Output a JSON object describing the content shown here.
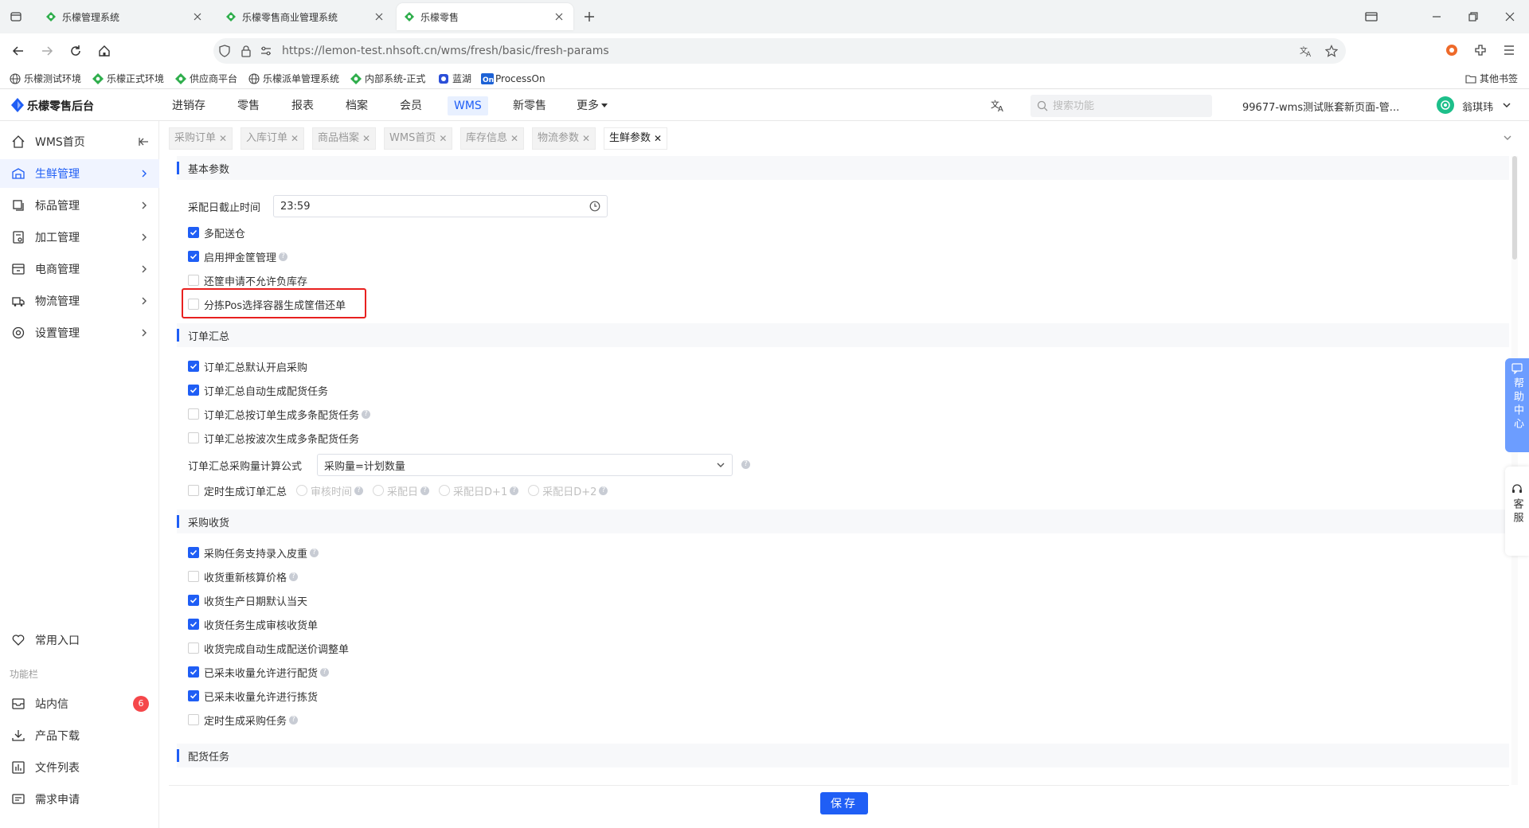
{
  "browser": {
    "tabs": [
      {
        "label": "乐檬管理系统",
        "active": false
      },
      {
        "label": "乐檬零售商业管理系统",
        "active": false
      },
      {
        "label": "乐檬零售",
        "active": true
      }
    ],
    "url": "https://lemon-test.nhsoft.cn/wms/fresh/basic/fresh-params",
    "bookmarks": [
      "乐檬测试环境",
      "乐檬正式环境",
      "供应商平台",
      "乐檬派单管理系统",
      "内部系统-正式",
      "蓝湖",
      "ProcessOn"
    ],
    "other_bookmarks": "其他书签"
  },
  "app": {
    "logo": "乐檬零售后台",
    "nav": [
      "进销存",
      "零售",
      "报表",
      "档案",
      "会员",
      "WMS",
      "新零售",
      "更多"
    ],
    "active_nav": "WMS",
    "search_placeholder": "搜索功能",
    "account": "99677-wms测试账套新页面-管...",
    "user": "翁琪玮"
  },
  "sidebar": {
    "items": [
      {
        "label": "WMS首页",
        "icon": "home-icon"
      },
      {
        "label": "生鲜管理",
        "icon": "fresh-icon",
        "active": true
      },
      {
        "label": "标品管理",
        "icon": "standard-icon"
      },
      {
        "label": "加工管理",
        "icon": "process-icon"
      },
      {
        "label": "电商管理",
        "icon": "ecommerce-icon"
      },
      {
        "label": "物流管理",
        "icon": "logistics-icon"
      },
      {
        "label": "设置管理",
        "icon": "settings-icon"
      }
    ],
    "favorites": "常用入口",
    "section_label": "功能栏",
    "tools": [
      {
        "label": "站内信",
        "badge": "6"
      },
      {
        "label": "产品下载"
      },
      {
        "label": "文件列表"
      },
      {
        "label": "需求申请"
      }
    ]
  },
  "page_tabs": [
    "采购订单",
    "入库订单",
    "商品档案",
    "WMS首页",
    "库存信息",
    "物流参数",
    "生鲜参数"
  ],
  "active_page_tab": "生鲜参数",
  "sections": {
    "basic": {
      "title": "基本参数",
      "cutoff_label": "采配日截止时间",
      "cutoff_value": "23:59",
      "options": [
        {
          "label": "多配送仓",
          "checked": true
        },
        {
          "label": "启用押金筐管理",
          "checked": true
        },
        {
          "label": "还筐申请不允许负库存",
          "checked": false
        },
        {
          "label": "分拣Pos选择容器生成筐借还单",
          "checked": false
        }
      ]
    },
    "order_summary": {
      "title": "订单汇总",
      "options": [
        {
          "label": "订单汇总默认开启采购",
          "checked": true
        },
        {
          "label": "订单汇总自动生成配货任务",
          "checked": true
        },
        {
          "label": "订单汇总按订单生成多条配货任务",
          "checked": false
        },
        {
          "label": "订单汇总按波次生成多条配货任务",
          "checked": false
        }
      ],
      "formula_label": "订单汇总采购量计算公式",
      "formula_value": "采购量=计划数量",
      "timed_label": "定时生成订单汇总",
      "timed_options": [
        "审核时间",
        "采配日",
        "采配日D+1",
        "采配日D+2"
      ]
    },
    "purchase_receive": {
      "title": "采购收货",
      "options": [
        {
          "label": "采购任务支持录入皮重",
          "checked": true
        },
        {
          "label": "收货重新核算价格",
          "checked": false
        },
        {
          "label": "收货生产日期默认当天",
          "checked": true
        },
        {
          "label": "收货任务生成审核收货单",
          "checked": true
        },
        {
          "label": "收货完成自动生成配送价调整单",
          "checked": false
        },
        {
          "label": "已采未收量允许进行配货",
          "checked": true
        },
        {
          "label": "已采未收量允许进行拣货",
          "checked": true
        },
        {
          "label": "定时生成采购任务",
          "checked": false
        }
      ]
    },
    "distribution": {
      "title": "配货任务"
    }
  },
  "save_label": "保存",
  "float": {
    "help_center": "帮助中心",
    "customer_service": "客服"
  },
  "colors": {
    "primary": "#1f5ef5",
    "highlight_border": "#e8201f",
    "badge": "#f5474a"
  }
}
